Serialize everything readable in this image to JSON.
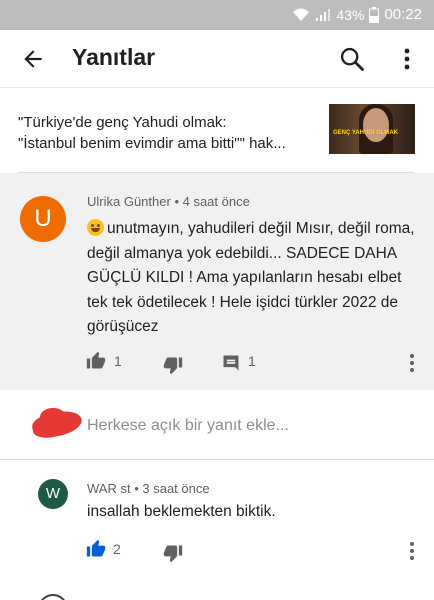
{
  "status_bar": {
    "battery": "43%",
    "time": "00:22"
  },
  "app_bar": {
    "title": "Yanıtlar"
  },
  "video": {
    "title_line1": "\"Türkiye'de genç Yahudi olmak:",
    "title_line2": "\"İstanbul benim evimdir ama bitti\"\" hak...",
    "thumbnail_text": "GENÇ YAHUDİ OLMAK"
  },
  "main_comment": {
    "avatar_letter": "U",
    "author": "Ulrika Günther",
    "time": "4 saat önce",
    "text": "unutmayın, yahudileri değil Mısır, değil roma, değil almanya yok edebildi... SADECE DAHA GÜÇLÜ KILDI ! Ama yapılanların hesabı elbet tek tek ödetilecek ! Hele işidci türkler 2022 de görüşücez",
    "like_count": "1",
    "reply_count": "1"
  },
  "reply_input": {
    "placeholder": "Herkese açık bir yanıt ekle..."
  },
  "reply": {
    "avatar_letter": "W",
    "author": "WAR st",
    "time": "3 saat önce",
    "text": "insallah beklemekten biktik.",
    "like_count": "2"
  },
  "colors": {
    "accent_like": "#065fd4",
    "avatar_u": "#ef6c00",
    "avatar_w": "#1e5b46",
    "redaction": "#e53935"
  },
  "icons": [
    "wifi-icon",
    "signal-icon",
    "battery-icon",
    "back-arrow-icon",
    "search-icon",
    "more-vert-icon",
    "thumb-up-icon",
    "thumb-down-icon",
    "comment-icon",
    "emoji-grin-icon"
  ]
}
